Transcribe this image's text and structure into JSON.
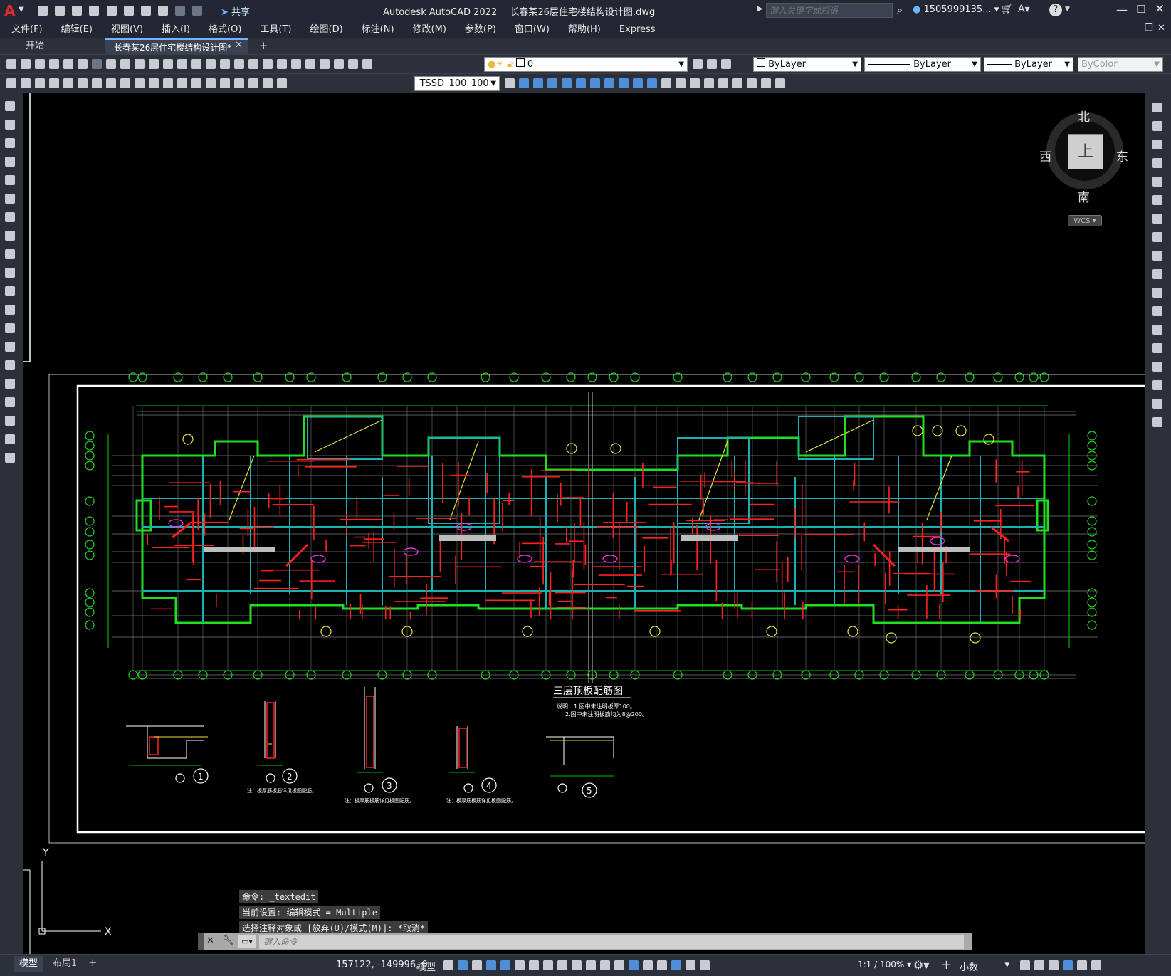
{
  "titlebar": {
    "app_title": "Autodesk AutoCAD 2022",
    "file_title": "长春某26层住宅楼结构设计图.dwg",
    "share_label": "共享",
    "search_placeholder": "键入关键字或短语",
    "user_label": "1505999135...",
    "colors": {
      "bg": "#222733",
      "accent": "#c8102e",
      "share": "#6fb6ff"
    }
  },
  "menu": {
    "items": [
      "文件(F)",
      "编辑(E)",
      "视图(V)",
      "插入(I)",
      "格式(O)",
      "工具(T)",
      "绘图(D)",
      "标注(N)",
      "修改(M)",
      "参数(P)",
      "窗口(W)",
      "帮助(H)",
      "Express"
    ]
  },
  "tabs": {
    "start": "开始",
    "active": "长春某26层住宅楼结构设计图*",
    "add": "+"
  },
  "toolbar1": {
    "layer_value": "0",
    "color_value": "ByLayer",
    "linetype_value": "ByLayer",
    "lineweight_value": "ByLayer",
    "plotstyle_value": "ByColor"
  },
  "toolbar2": {
    "dimstyle_value": "TSSD_100_100"
  },
  "viewcube": {
    "north": "北",
    "south": "南",
    "east": "东",
    "west": "西",
    "top": "上",
    "wcs": "WCS"
  },
  "drawing": {
    "title": "三层顶板配筋图",
    "note1": "说明：1.图中未注明板厚100。",
    "note2": "2.图中未注明板筋均为8@200。",
    "details": [
      "1",
      "2",
      "3",
      "4",
      "5"
    ],
    "detail_note": "注：板厚筋板筋详见板图配筋。"
  },
  "ucs": {
    "x": "X",
    "y": "Y"
  },
  "command": {
    "history": [
      "命令: _textedit",
      "当前设置: 编辑模式 = Multiple",
      "选择注释对象或 [放弃(U)/模式(M)]: *取消*"
    ],
    "placeholder": "键入命令"
  },
  "status": {
    "model_tab": "模型",
    "layout_tab": "布局1",
    "add_tab": "+",
    "coords": "157122, -149996, 0",
    "model_label": "模型",
    "scale": "1:1 / 100%",
    "units": "小数"
  }
}
